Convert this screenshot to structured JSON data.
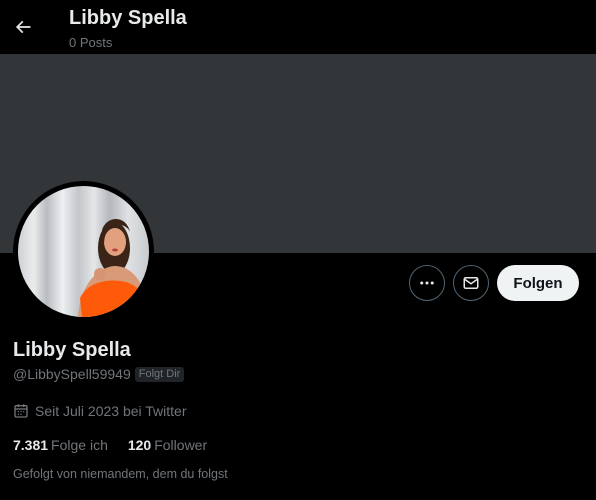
{
  "header": {
    "title": "Libby Spella",
    "posts_count": "0 Posts"
  },
  "profile": {
    "display_name": "Libby Spella",
    "handle": "@LibbySpell59949",
    "follows_you_badge": "Folgt Dir",
    "joined": "Seit Juli 2023 bei Twitter",
    "following_count": "7.381",
    "following_label": "Folge ich",
    "followers_count": "120",
    "followers_label": "Follower",
    "followed_by": "Gefolgt von niemandem, dem du folgst"
  },
  "actions": {
    "follow_label": "Folgen",
    "more_icon": "more-horizontal-icon",
    "message_icon": "envelope-icon"
  },
  "colors": {
    "background": "#000000",
    "banner": "#333639",
    "primary_text": "#e7e9ea",
    "secondary_text": "#71767b",
    "follow_button_bg": "#eff3f4"
  }
}
